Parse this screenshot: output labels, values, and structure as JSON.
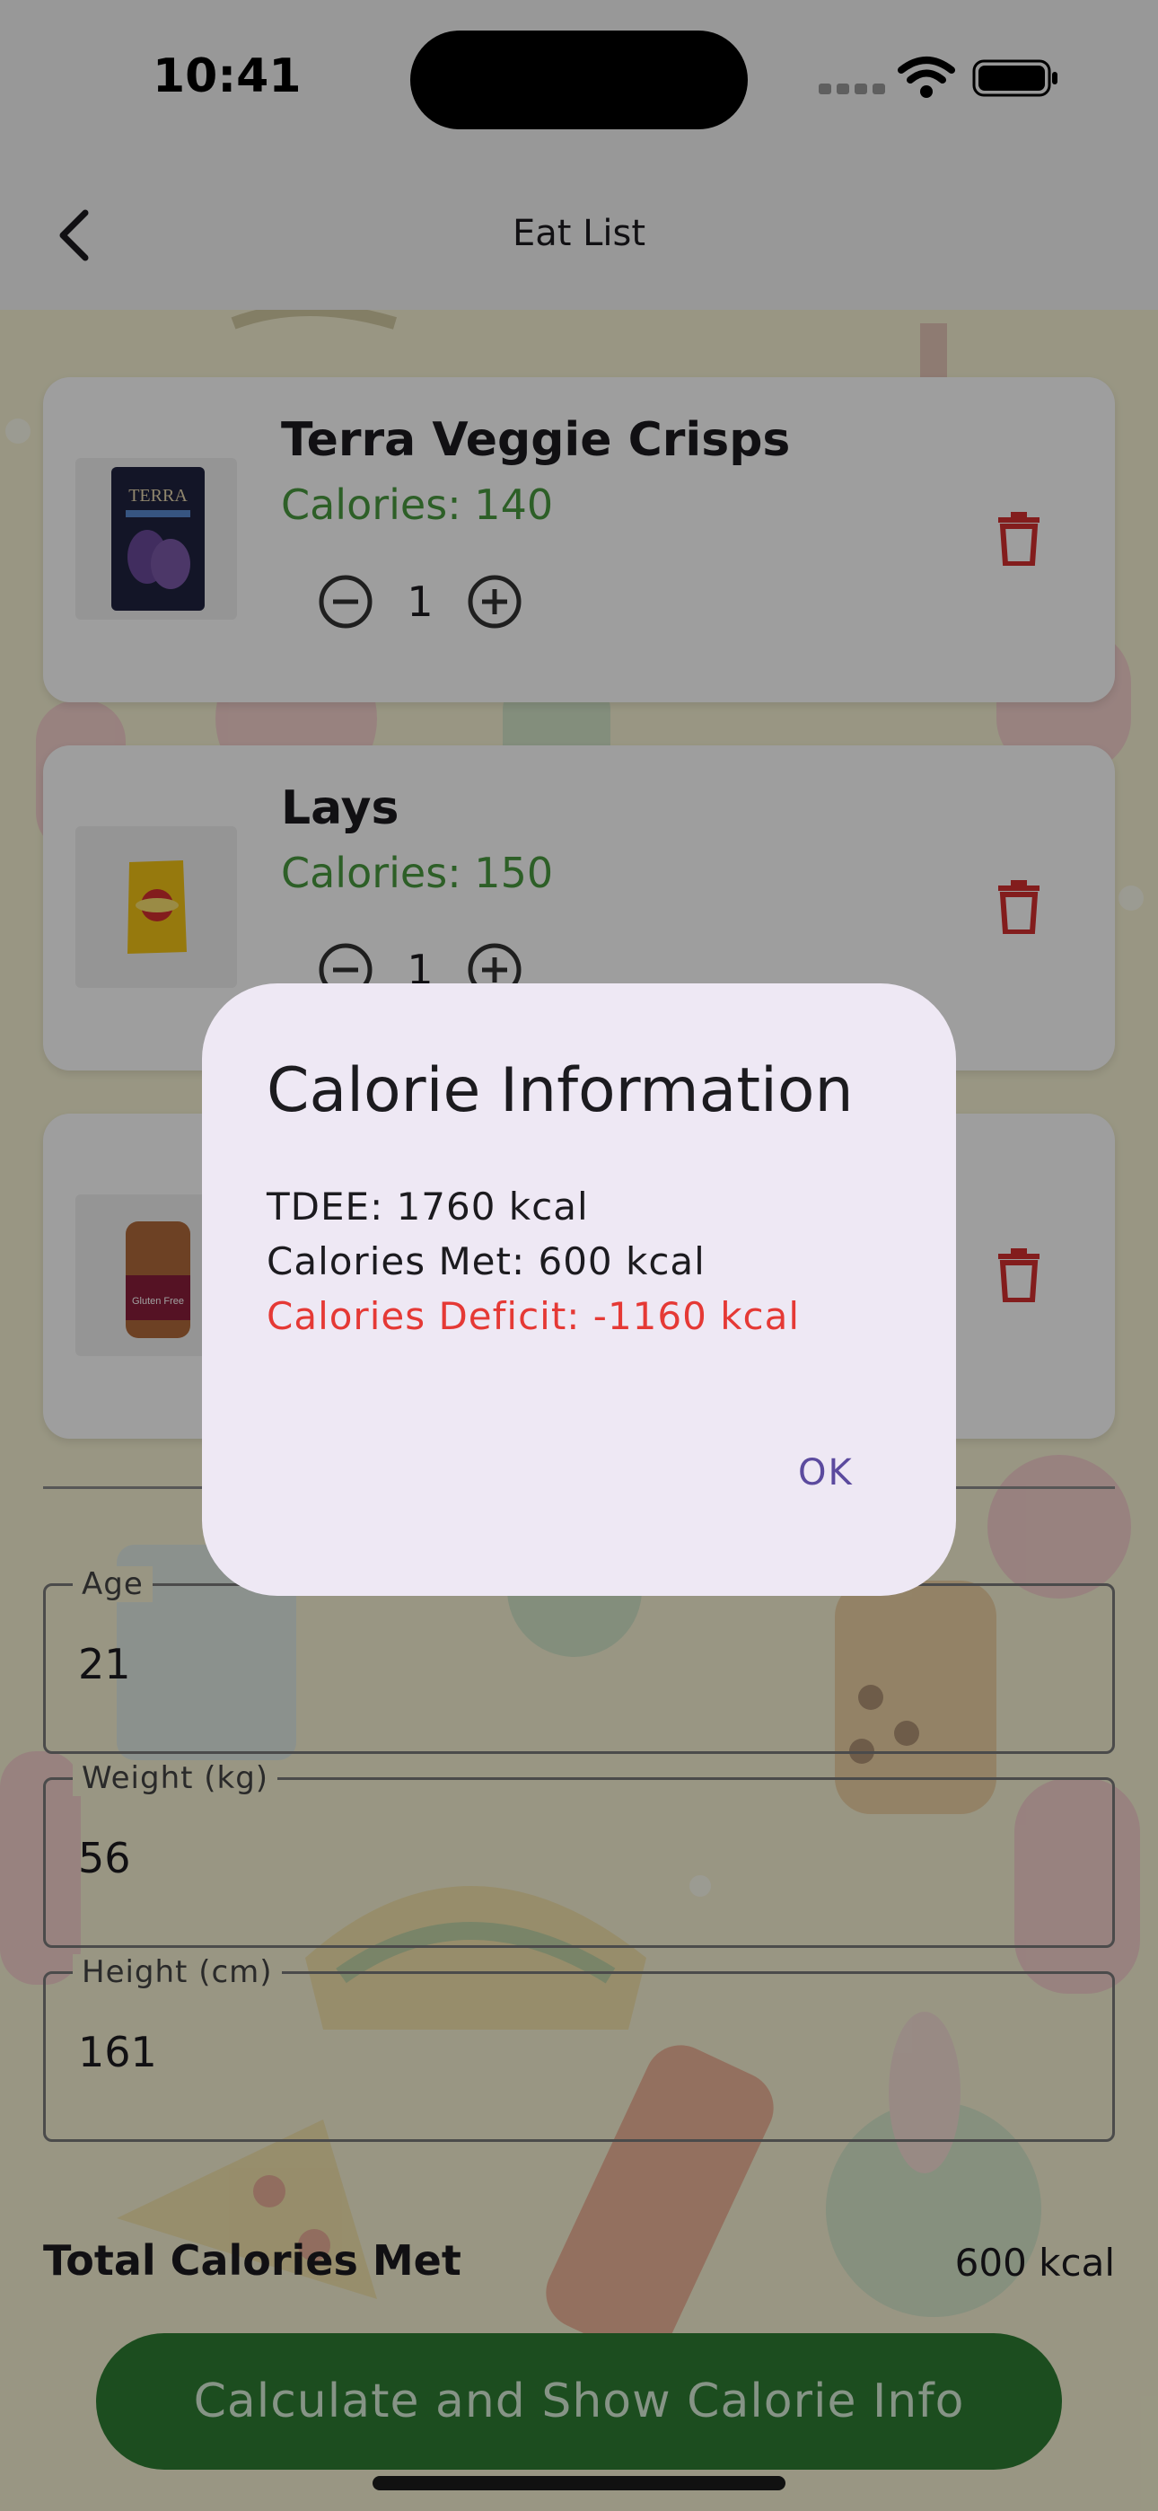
{
  "status_bar": {
    "time": "10:41"
  },
  "app_bar": {
    "title": "Eat List"
  },
  "items": [
    {
      "name": "Terra Veggie Crisps",
      "calories": "Calories: 140",
      "quantity": "1"
    },
    {
      "name": "Lays",
      "calories": "Calories: 150",
      "quantity": "1"
    },
    {
      "name": "",
      "calories": "",
      "quantity": ""
    }
  ],
  "item_image_labels": {
    "terra": "TERRA",
    "canyon": "Gluten Free"
  },
  "form": {
    "age_label": "Age",
    "age_value": "21",
    "weight_label": "Weight (kg)",
    "weight_value": "56",
    "height_label": "Height (cm)",
    "height_value": "161"
  },
  "totals": {
    "label": "Total Calories Met",
    "value": "600 kcal"
  },
  "calc_button": "Calculate and Show Calorie Info",
  "dialog": {
    "title": "Calorie Information",
    "tdee": "TDEE: 1760 kcal",
    "met": "Calories Met: 600 kcal",
    "deficit": "Calories Deficit: -1160 kcal",
    "ok": "OK"
  },
  "colors": {
    "calorie_green": "#4a9a3f",
    "delete_red": "#d32f2f",
    "button_green": "#2e7d32",
    "deficit_red": "#e53935",
    "dialog_accent": "#5b4a9e"
  }
}
